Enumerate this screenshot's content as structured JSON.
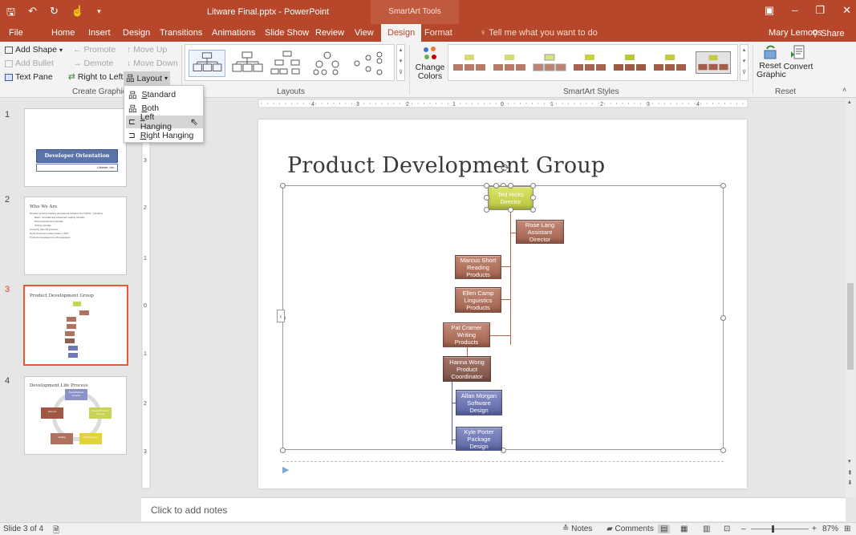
{
  "app": {
    "doc_title": "Litware Final.pptx - PowerPoint",
    "context_tools": "SmartArt Tools",
    "user": "Mary Lemons",
    "share": "Share",
    "tell_me": "Tell me what you want to do"
  },
  "tabs": [
    "File",
    "Home",
    "Insert",
    "Design",
    "Transitions",
    "Animations",
    "Slide Show",
    "Review",
    "View",
    "Design",
    "Format"
  ],
  "ribbon": {
    "create_graphic": {
      "add_shape": "Add Shape",
      "add_bullet": "Add Bullet",
      "text_pane": "Text Pane",
      "promote": "Promote",
      "demote": "Demote",
      "right_to_left": "Right to Left",
      "move_up": "Move Up",
      "move_down": "Move Down",
      "layout": "Layout",
      "label": "Create Graphic"
    },
    "layouts_label": "Layouts",
    "change_colors": "Change Colors",
    "smartart_styles_label": "SmartArt Styles",
    "reset_graphic": "Reset Graphic",
    "convert": "Convert",
    "reset_label": "Reset"
  },
  "layout_menu": [
    {
      "label": "Standard",
      "hotkey": "S",
      "rest": "tandard"
    },
    {
      "label": "Both",
      "hotkey": "B",
      "rest": "oth"
    },
    {
      "label": "Left Hanging",
      "hotkey": "L",
      "rest": "eft Hanging"
    },
    {
      "label": "Right Hanging",
      "hotkey": "R",
      "rest": "ight Hanging"
    }
  ],
  "thumbnails": [
    {
      "num": "1",
      "title": "Developer Orientation",
      "sub": "Litware, Inc."
    },
    {
      "num": "2",
      "title": "Who We Are",
      "bullets": [
        "Develop industry-leading educational software for children, including:",
        "Basic, remedial and advanced reading tutorials",
        "Phonics/phonetics tutorials",
        "Writing tutorials",
        "Currently offer 55 products",
        "North American market share 7-45%",
        "Products translated into 15 languages"
      ]
    },
    {
      "num": "3",
      "title": "Product Development Group"
    },
    {
      "num": "4",
      "title": "Development Life Process",
      "cycle": [
        "Needs/Market analysis",
        "Design/Proof of concept",
        "Development",
        "Testing",
        "Roll-out"
      ]
    }
  ],
  "slide": {
    "title": "Product Development Group",
    "nodes": [
      {
        "name": "Ted Hicks",
        "role": "Director"
      },
      {
        "name": "Rose Lang",
        "role": "Assistant Director"
      },
      {
        "name": "Marcus Short",
        "role": "Reading Products"
      },
      {
        "name": "Ellen Camp",
        "role": "Linguistics Products"
      },
      {
        "name": "Pat Cramer",
        "role": "Writing Products"
      },
      {
        "name": "Hanna Wong",
        "role": "Product Coordinator"
      },
      {
        "name": "Allan Morgan",
        "role": "Software Design"
      },
      {
        "name": "Kyle Porter",
        "role": "Package Design"
      }
    ]
  },
  "notes_placeholder": "Click to add notes",
  "status": {
    "slide": "Slide 3 of 4",
    "notes": "Notes",
    "comments": "Comments",
    "zoom": "87%"
  },
  "colors": {
    "brand": "#b7472a",
    "node_green": "#c7d352",
    "node_brown": "#b07260",
    "node_blue": "#6f78b4"
  }
}
